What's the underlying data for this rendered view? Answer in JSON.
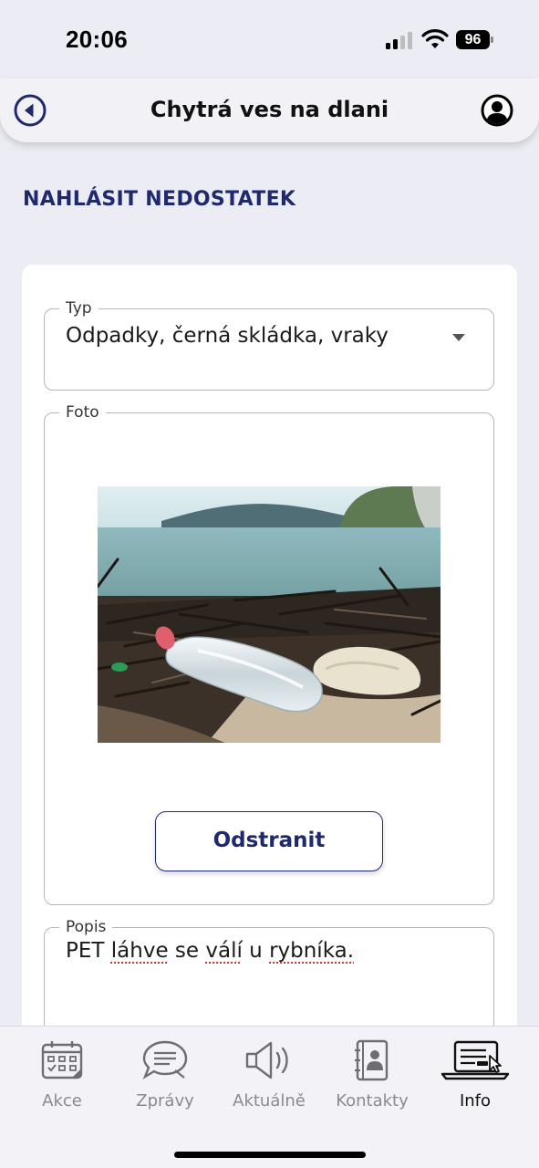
{
  "status_bar": {
    "time": "20:06",
    "battery": "96"
  },
  "header": {
    "title": "Chytrá ves na dlani",
    "back_icon": "back-arrow-circle-icon",
    "profile_icon": "user-profile-icon"
  },
  "page": {
    "heading": "NAHLÁSIT NEDOSTATEK"
  },
  "form": {
    "type": {
      "label": "Typ",
      "value": "Odpadky, černá skládka, vraky"
    },
    "photo": {
      "label": "Foto",
      "remove_label": "Odstranit"
    },
    "description": {
      "label": "Popis",
      "words": [
        "PET",
        "láhve",
        "se",
        "válí",
        "u",
        "rybníka."
      ]
    }
  },
  "tabbar": {
    "tabs": [
      {
        "label": "Akce",
        "icon": "calendar-icon"
      },
      {
        "label": "Zprávy",
        "icon": "chat-bubble-icon"
      },
      {
        "label": "Aktuálně",
        "icon": "speaker-icon"
      },
      {
        "label": "Kontakty",
        "icon": "contact-book-icon"
      },
      {
        "label": "Info",
        "icon": "laptop-cursor-icon"
      }
    ],
    "active": "Info"
  },
  "colors": {
    "accent": "#1f2a6e",
    "background": "#ecedf4",
    "inactive_tab": "#8a8a8e"
  }
}
